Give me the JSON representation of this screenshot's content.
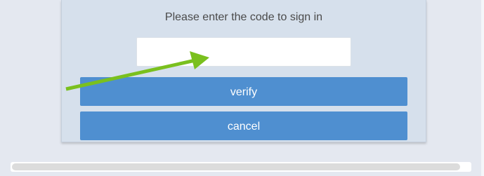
{
  "dialog": {
    "prompt": "Please enter the code to sign in",
    "code_input": {
      "value": "",
      "placeholder": ""
    },
    "verify_label": "verify",
    "cancel_label": "cancel"
  },
  "colors": {
    "page_background": "#e4e8f0",
    "dialog_background": "#d6e0ec",
    "button": "#4f8fd0",
    "button_text": "#ffffff",
    "annotation_arrow": "#7ac01e"
  },
  "annotation": {
    "icon": "pointer-arrow-icon"
  }
}
